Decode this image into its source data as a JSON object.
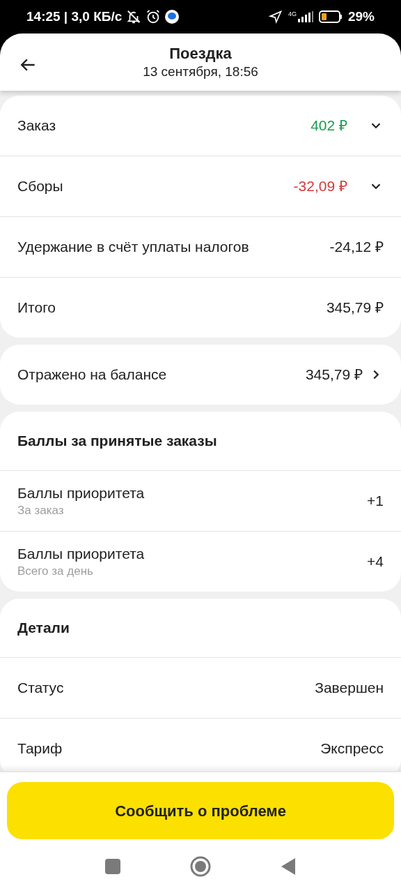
{
  "status_bar": {
    "time": "14:25 | 3,0 КБ/с",
    "network": "4G",
    "battery": "29%"
  },
  "header": {
    "title": "Поездка",
    "subtitle": "13 сентября, 18:56"
  },
  "sections": [
    {
      "rows": [
        {
          "kind": "expand",
          "label": "Заказ",
          "value": "402 ₽",
          "color": "#1a9b50",
          "expanded": false
        },
        {
          "kind": "expand",
          "label": "Сборы",
          "value": "-32,09 ₽",
          "color": "#d13b3b",
          "expanded": false
        },
        {
          "kind": "plain",
          "label": "Удержание в счёт уплаты налогов",
          "value": "-24,12 ₽",
          "color": "#212121"
        },
        {
          "kind": "plain",
          "label": "Итого",
          "value": "345,79 ₽",
          "color": "#212121"
        }
      ]
    },
    {
      "rows": [
        {
          "kind": "link",
          "label": "Отражено на балансе",
          "value": "345,79 ₽",
          "color": "#212121"
        }
      ]
    },
    {
      "title": "Баллы за принятые заказы",
      "rows": [
        {
          "kind": "plain",
          "label": "Баллы приоритета",
          "sublabel": "За заказ",
          "value": "+1",
          "color": "#212121"
        },
        {
          "kind": "plain",
          "label": "Баллы приоритета",
          "sublabel": "Всего за день",
          "value": "+4",
          "color": "#212121"
        }
      ]
    },
    {
      "title": "Детали",
      "rows": [
        {
          "kind": "plain",
          "label": "Статус",
          "value": "Завершен",
          "color": "#212121"
        },
        {
          "kind": "plain",
          "label": "Тариф",
          "value": "Экспресс",
          "color": "#212121"
        }
      ]
    }
  ],
  "report_button": "Сообщить о проблеме"
}
